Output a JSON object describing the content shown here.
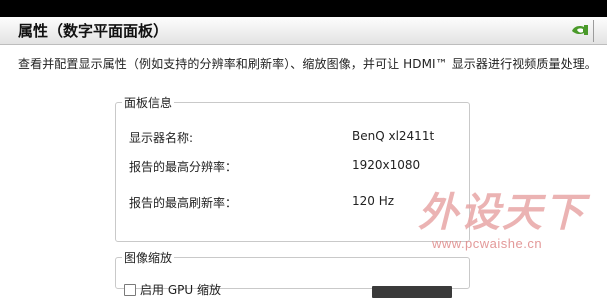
{
  "header": {
    "title": "属性（数字平面面板）",
    "icon": "nvidia-icon",
    "icon_color": "#4a9a2a"
  },
  "description": "查看并配置显示属性（例如支持的分辨率和刷新率）、缩放图像，并可让 HDMI™ 显示器进行视频质量处理。",
  "panel_info": {
    "legend": "面板信息",
    "rows": [
      {
        "label": "显示器名称:",
        "value": "BenQ xl2411t"
      },
      {
        "label": "报告的最高分辨率：",
        "value": "1920x1080"
      },
      {
        "label": "报告的最高刷新率：",
        "value": "120 Hz"
      }
    ]
  },
  "panel_scale": {
    "legend": "图像缩放",
    "checkbox_label": "启用 GPU 缩放",
    "checkbox_checked": false
  },
  "watermark": {
    "logo": "外设天下",
    "url": "www.pcwaishe.cn"
  }
}
